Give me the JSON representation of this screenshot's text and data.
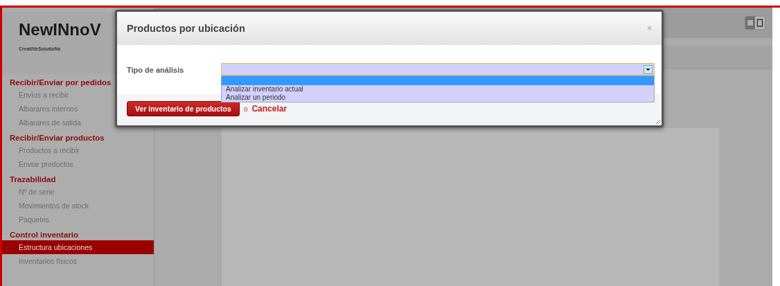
{
  "brand": {
    "name": "NewINnoV",
    "tagline": "CreatiVeSolutioNs"
  },
  "sidebar": {
    "sections": [
      {
        "title": "Recibir/Enviar por pedidos",
        "items": [
          {
            "label": "Envíos a recibir",
            "selected": false
          },
          {
            "label": "Albarares internos",
            "selected": false
          },
          {
            "label": "Albarares de salida",
            "selected": false
          }
        ]
      },
      {
        "title": "Recibir/Enviar productos",
        "items": [
          {
            "label": "Productos a recibir",
            "selected": false
          },
          {
            "label": "Enviar productos",
            "selected": false
          }
        ]
      },
      {
        "title": "Trazabilidad",
        "items": [
          {
            "label": "Nº de serie",
            "selected": false
          },
          {
            "label": "Movimientos de stock",
            "selected": false
          },
          {
            "label": "Paquetes",
            "selected": false
          }
        ]
      },
      {
        "title": "Control inventario",
        "items": [
          {
            "label": "Estructura ubicaciones",
            "selected": true
          },
          {
            "label": "Inventarios físicos",
            "selected": false
          }
        ]
      }
    ]
  },
  "view_switch": [
    {
      "kind": "list",
      "selected": true
    },
    {
      "kind": "form",
      "selected": false
    }
  ],
  "dialog": {
    "title": "Productos por ubicación",
    "close": "×",
    "field_label": "Tipo de análisis",
    "options": [
      {
        "selected": true
      },
      {
        "label": "Analizar inventario actual",
        "selected": false
      },
      {
        "label": "Analizar un periodo",
        "selected": false
      }
    ],
    "primary_button": "Ver inventario de productos",
    "separator": "o",
    "cancel": "Cancelar"
  }
}
